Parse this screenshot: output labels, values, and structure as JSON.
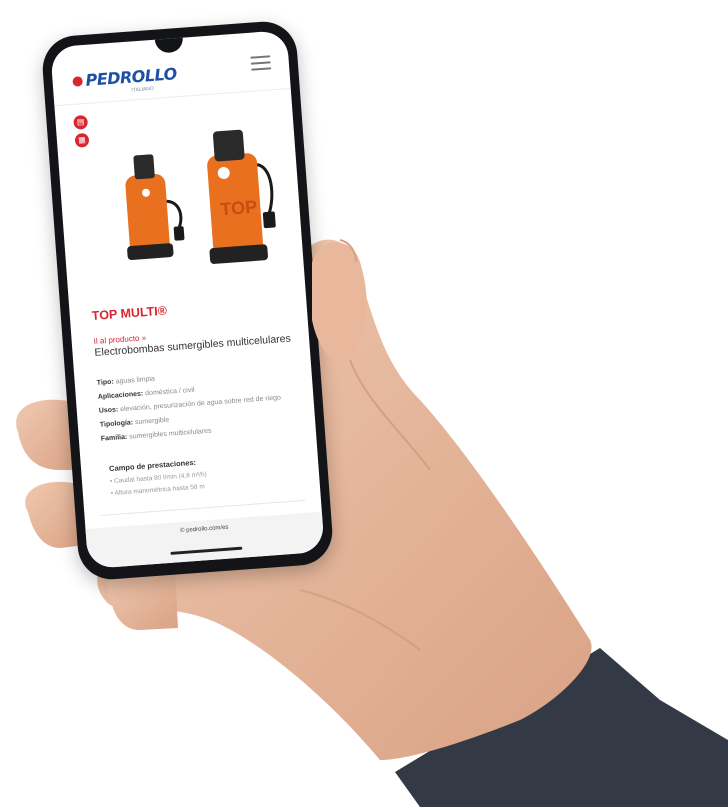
{
  "brand": {
    "name": "PEDROLLO",
    "tagline": "ITALIANO"
  },
  "product": {
    "title": "TOP MULTI®",
    "crumb": "Il al producto »",
    "subtitle": "Electrobombas sumergibles multicelulares"
  },
  "specs": [
    {
      "label": "Tipo:",
      "value": "aguas limpia"
    },
    {
      "label": "Aplicaciones:",
      "value": "doméstica / civil"
    },
    {
      "label": "Usos:",
      "value": "elevación, presurización de agua sobre red de riego"
    },
    {
      "label": "Tipología:",
      "value": "sumergible"
    },
    {
      "label": "Familia:",
      "value": "sumergibles multicelulares"
    }
  ],
  "performance": {
    "heading": "Campo de prestaciones:",
    "items": [
      "Caudal hasta 80 l/min (4,8 m³/h)",
      "Altura manométrica hasta 58 m"
    ]
  },
  "footer": {
    "link": "© pedrollo.com/es"
  },
  "colors": {
    "accent": "#d8262f",
    "brand_blue": "#1e4fa6",
    "pump_orange": "#e8701f",
    "skin": "#e7b79d",
    "sleeve": "#333a46"
  },
  "icons": [
    "menu-icon",
    "pdf-icon",
    "catalog-icon"
  ]
}
